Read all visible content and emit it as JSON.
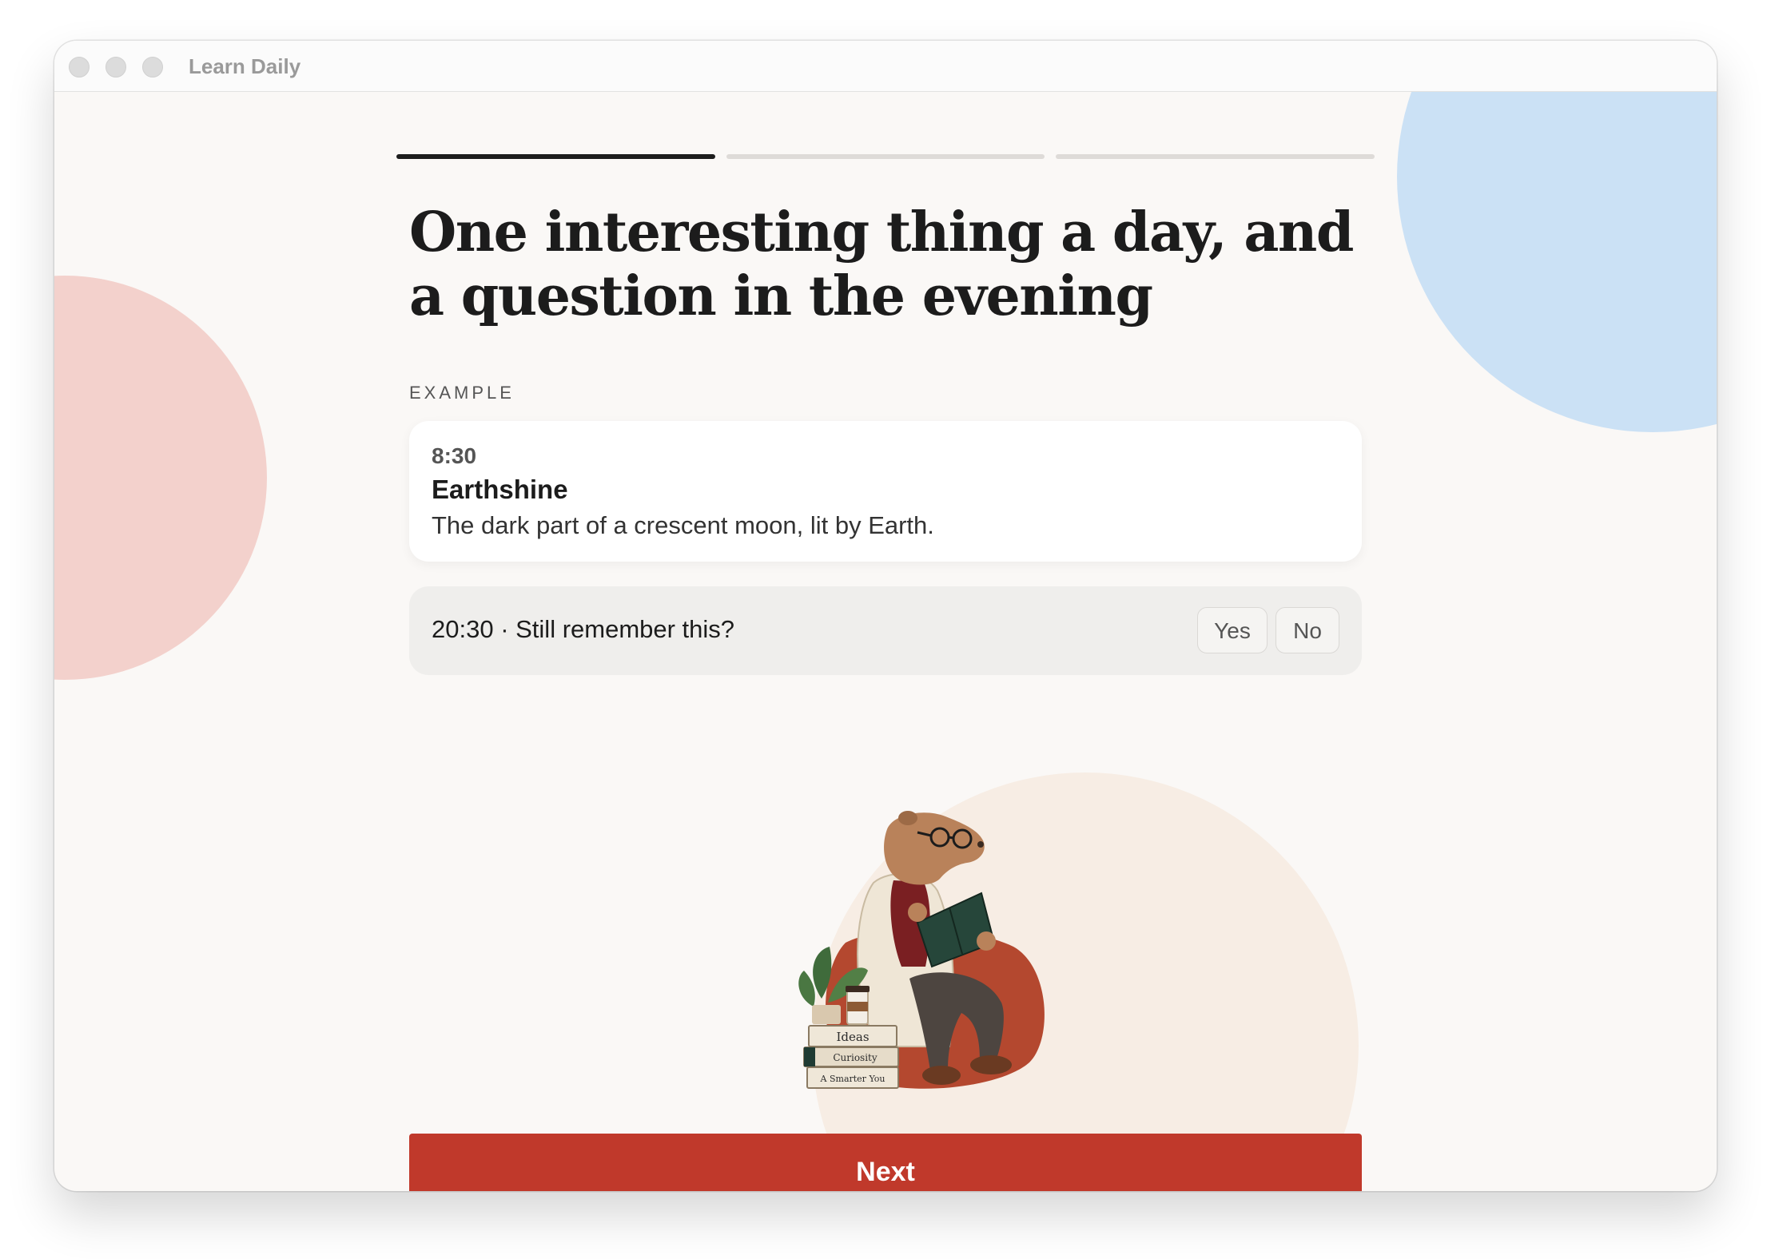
{
  "window": {
    "title": "Learn Daily"
  },
  "progress": {
    "current_step": 1,
    "total_steps": 3
  },
  "heading": "One interesting thing a day, and a question in the evening",
  "section_label": "EXAMPLE",
  "example_card": {
    "time": "8:30",
    "title": "Earthshine",
    "body": "The dark part of a crescent moon, lit by Earth."
  },
  "recall_card": {
    "text": "20:30 · Still remember this?",
    "yes_label": "Yes",
    "no_label": "No"
  },
  "illustration": {
    "book_titles": [
      "Ideas",
      "Curiosity",
      "A Smarter You"
    ]
  },
  "next_button": {
    "label": "Next"
  },
  "colors": {
    "accent": "#c0392b",
    "background": "#faf8f6",
    "blob_pink": "#f3d1cc",
    "blob_blue": "#cbe1f5",
    "blob_beige": "#f7ede4"
  }
}
